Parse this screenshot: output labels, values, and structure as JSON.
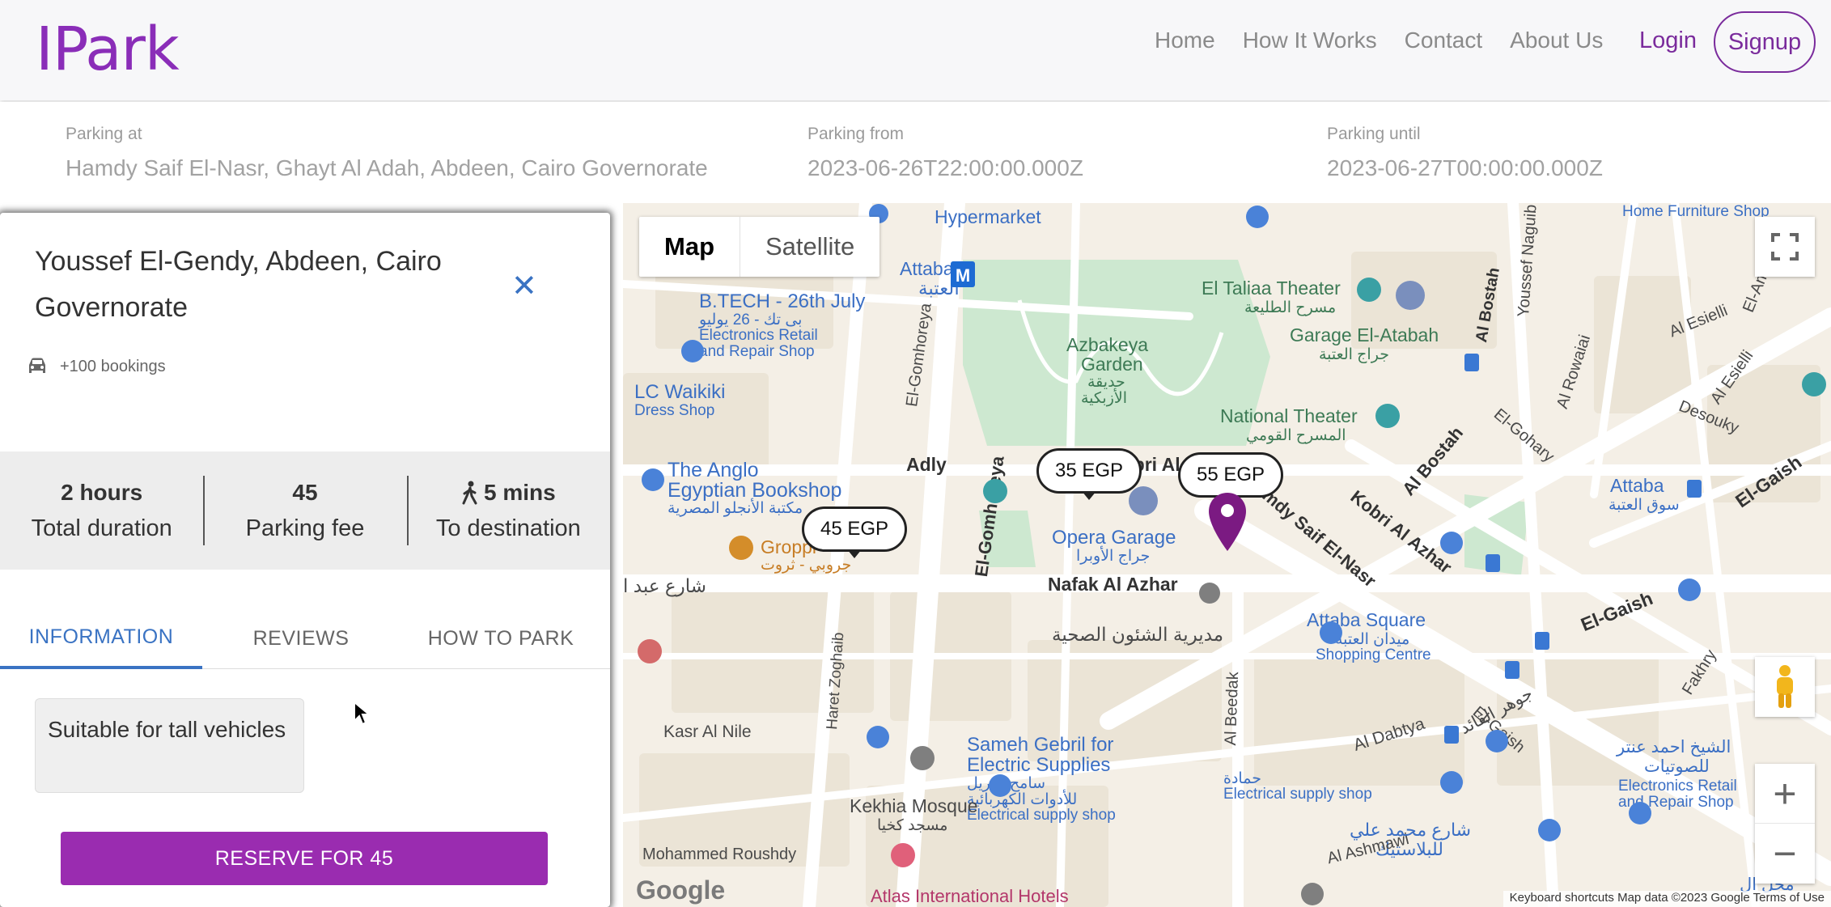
{
  "nav": {
    "logo": "IPark",
    "links": [
      "Home",
      "How It Works",
      "Contact",
      "About Us"
    ],
    "login": "Login",
    "signup": "Signup"
  },
  "search": {
    "parking_at_label": "Parking at",
    "parking_at_value": "Hamdy Saif El-Nasr, Ghayt Al Adah, Abdeen, Cairo Governorate",
    "parking_from_label": "Parking from",
    "parking_from_value": "2023-06-26T22:00:00.000Z",
    "parking_until_label": "Parking until",
    "parking_until_value": "2023-06-27T00:00:00.000Z"
  },
  "panel": {
    "title": "Youssef El-Gendy, Abdeen, Cairo Governorate",
    "bookings": "+100 bookings",
    "stats": [
      {
        "value": "2 hours",
        "label": "Total duration"
      },
      {
        "value": "45",
        "label": "Parking fee"
      },
      {
        "value": "5 mins",
        "label": "To destination"
      }
    ],
    "tabs": [
      "INFORMATION",
      "REVIEWS",
      "HOW TO PARK"
    ],
    "active_tab": "INFORMATION",
    "feature_chip": "Suitable for tall vehicles",
    "reserve_button": "RESERVE FOR 45"
  },
  "map": {
    "map_type": [
      "Map",
      "Satellite"
    ],
    "selected_map_type": "Map",
    "price_markers": [
      "45 EGP",
      "35 EGP",
      "55 EGP"
    ],
    "labels": {
      "hypermarket": "Hypermarket",
      "attaba": "Attaba",
      "attaba_ar": "العتبة",
      "btech1": "B.TECH - 26th July",
      "btech2": "بى تك - 26 يوليو",
      "btech3": "Electronics Retail",
      "btech4": "and Repair Shop",
      "lcwaikiki1": "LC Waikiki",
      "lcwaikiki2": "Dress Shop",
      "gomhoreya1": "El-Gomhoreya",
      "azbakeya1": "Azbakeya",
      "azbakeya2": "Garden",
      "azbakeya3": "حديقة",
      "azbakeya4": "الأزبكية",
      "taliaa1": "El Taliaa Theater",
      "taliaa2": "مسرح الطليعة",
      "garage_atabah1": "Garage El-Atabah",
      "garage_atabah2": "جراج العتبة",
      "national1": "National Theater",
      "national2": "المسرح القومي",
      "bostah1": "Al Bostah",
      "bostah2": "Al Bostah",
      "adly": "Adly",
      "anglo1": "The Anglo",
      "anglo2": "Egyptian Bookshop",
      "anglo3": "مكتبة الأنجلو المصرية",
      "groppi1": "Groppi",
      "groppi_ar": "جروبي - ثروت",
      "opera1": "Opera Garage",
      "opera2": "جراج الأوبرا",
      "kobri": "Kobri Al",
      "hamdy": "Hamdy Saif El-Nasr",
      "kobri_azhar": "Kobri Al Azhar",
      "nafak": "Nafak Al Azhar",
      "moderia": "مديرية الشئون الصحية",
      "abdel": "شارع عبد ا",
      "attaba_sq1": "Attaba Square",
      "attaba_sq2": "ميدان العتبة",
      "attaba_sq3": "Shopping Centre",
      "attaba_mkt1": "Attaba",
      "attaba_mkt2": "سوق العتبة",
      "elgaish": "El-Gaish",
      "elgaish2": "El-Gaish",
      "elgaish3": "El-Gaish",
      "elgohary": "El-Gohary",
      "desouky": "Desouky",
      "alrowaiai": "Al Rowaiai",
      "naguib": "Youssef Naguib",
      "esielli": "Al Esielli",
      "esielli2": "Al Esielli",
      "elamir": "El-Amir K",
      "home_furn": "Home Furniture Shop",
      "gawhar": "جوهر القائد",
      "fakhry": "Fakhry",
      "haret": "Haret Zoghaib",
      "kasr": "Kasr Al Nile",
      "sameh1": "Sameh Gebril for",
      "sameh2": "Electric Supplies",
      "sameh3": "سامح جبريل",
      "sameh4": "للأدوات الكهربائية",
      "sameh5": "Electrical supply shop",
      "hamada1": "حمادة",
      "hamada2": "Electrical supply shop",
      "dabtya": "Al Dabtya",
      "sheikh1": "الشيخ احمد عنتر",
      "sheikh2": "للصوتيات",
      "sheikh3": "Electronics Retail",
      "sheikh4": "and Repair Shop",
      "mohamed_ali1": "شارع محمد علي",
      "mohamed_ali2": "للبلاستيك",
      "kekhia1": "Kekhia Mosque",
      "kekhia2": "مسجد كخيا",
      "roushdy": "Mohammed Roushdy",
      "atlas": "Atlas International Hotels",
      "ashmawi": "Al Ashmawi",
      "beedak": "Al Beedak",
      "magal": "مجل ال"
    },
    "google": "Google",
    "footer": "Keyboard shortcuts   Map data ©2023 Google   Terms of Use"
  },
  "colors": {
    "brand": "#8a2db8",
    "button": "#9a2cb0",
    "tab_active": "#3a73c3",
    "pin": "#7b1a82"
  },
  "icons": {
    "close": "close-icon",
    "car": "car-icon",
    "walk": "walking-icon",
    "fullscreen": "fullscreen-icon",
    "pegman": "pegman-icon",
    "zoom_in": "plus-icon",
    "zoom_out": "minus-icon"
  }
}
